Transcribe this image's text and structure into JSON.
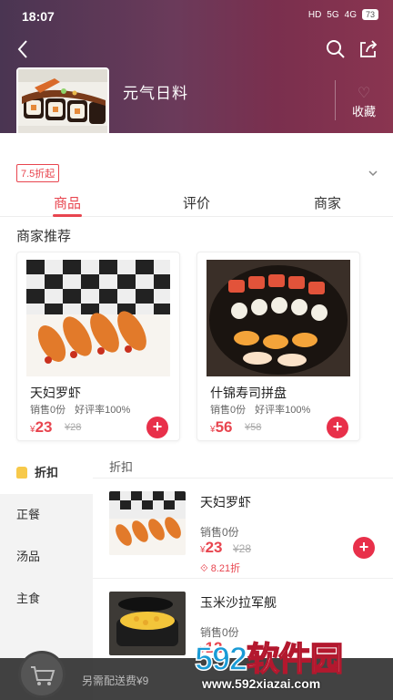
{
  "status_bar": {
    "time": "18:07",
    "hd": "HD",
    "signal_5g": "5G",
    "signal_4g": "4G",
    "battery": "73"
  },
  "shop": {
    "name": "元气日料",
    "favorite_label": "收藏",
    "discount_tag": "7.5折起"
  },
  "tabs": [
    {
      "label": "商品"
    },
    {
      "label": "评价"
    },
    {
      "label": "商家"
    }
  ],
  "recommend": {
    "title": "商家推荐",
    "items": [
      {
        "name": "天妇罗虾",
        "sales": "销售0份",
        "rating": "好评率100%",
        "currency": "¥",
        "price": "23",
        "old_price": "¥28",
        "image": "fried-shrimp"
      },
      {
        "name": "什锦寿司拼盘",
        "sales": "销售0份",
        "rating": "好评率100%",
        "currency": "¥",
        "price": "56",
        "old_price": "¥58",
        "image": "sushi-platter"
      }
    ]
  },
  "sidebar": {
    "items": [
      {
        "label": "折扣"
      },
      {
        "label": "正餐"
      },
      {
        "label": "汤品"
      },
      {
        "label": "主食"
      }
    ]
  },
  "list": {
    "heading": "折扣",
    "items": [
      {
        "name": "天妇罗虾",
        "sales": "销售0份",
        "currency": "¥",
        "price": "23",
        "old_price": "¥28",
        "discount": "8.21折",
        "image": "fried-shrimp"
      },
      {
        "name": "玉米沙拉军舰",
        "sales": "销售0份",
        "currency": "¥",
        "price": "12",
        "image": "corn-gunkan"
      }
    ]
  },
  "cart": {
    "delivery_note": "另需配送费¥9"
  },
  "watermark": {
    "brand": "592软件园",
    "brand_num": "592",
    "brand_text": "软件园",
    "url": "www.592xiazai.com"
  },
  "colors": {
    "accent": "#e8454f",
    "header_gradient_start": "#4a3552",
    "header_gradient_end": "#8a3550"
  }
}
